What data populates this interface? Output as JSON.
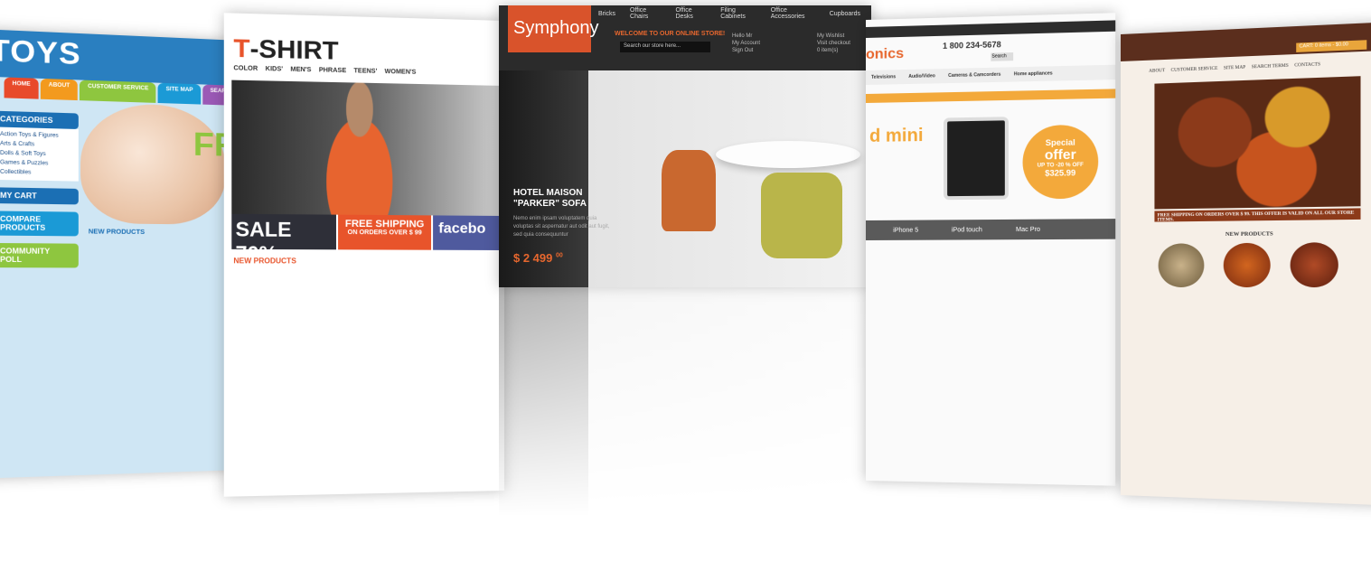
{
  "toys": {
    "logo": "TOYS",
    "nav": [
      "HOME",
      "ABOUT",
      "CUSTOMER SERVICE",
      "SITE MAP",
      "SEARCH TERMS"
    ],
    "categories_title": "CATEGORIES",
    "categories": [
      "Action Toys & Figures",
      "Arts & Crafts",
      "Dolls & Soft Toys",
      "Games & Puzzles",
      "Collectibles"
    ],
    "my_cart": "MY CART",
    "compare": "COMPARE PRODUCTS",
    "community": "COMMUNITY POLL",
    "new_products": "NEW PRODUCTS",
    "hero_text": "FR"
  },
  "tshirt": {
    "logo_first": "T",
    "logo_rest": "-SHIRT",
    "menu": [
      "COLOR",
      "KIDS'",
      "MEN'S",
      "PHRASE",
      "TEENS'",
      "WOMEN'S"
    ],
    "sale": "SALE 70%",
    "free_shipping": "FREE SHIPPING",
    "ship_sub": "ON ORDERS OVER $ 99",
    "facebook": "facebo",
    "new_products": "NEW PRODUCTS"
  },
  "symphony": {
    "brand": "Symphony",
    "nav": [
      "Bricks",
      "Office Chairs",
      "Office Desks",
      "Filing Cabinets",
      "Office Accessories",
      "Cupboards"
    ],
    "welcome": "WELCOME TO OUR ONLINE STORE!",
    "search_placeholder": "Search our store here...",
    "account_lines": [
      "Hello Mr",
      "My Account",
      "Sign Out",
      "My Wishlist",
      "Visit checkout",
      "0 item(s)"
    ],
    "hotel": "HOTEL MAISON",
    "sofa": "\"PARKER\" SOFA",
    "desc": "Nemo enim ipsam voluptatem quia voluptas sit aspernatur aut odit aut fugit, sed quia consequuntur",
    "price": "$ 2 499",
    "price_cents": "00"
  },
  "electronics": {
    "logo": "onics",
    "phone": "1 800 234-5678",
    "nav": [
      "Televisions",
      "Audio/Video",
      "Cameras & Camcorders",
      "Home appliances"
    ],
    "headline": "d mini",
    "offer_title": "Special",
    "offer_word": "offer",
    "offer_sub": "UP TO -20 % OFF",
    "offer_price": "$325.99",
    "tabs": [
      "iPhone 5",
      "iPod touch",
      "Mac Pro"
    ],
    "search": "Search"
  },
  "spices": {
    "nav": [
      "ABOUT",
      "CUSTOMER SERVICE",
      "SITE MAP",
      "SEARCH TERMS",
      "CONTACTS"
    ],
    "cart": "CART: 0 items - $0.00",
    "free_shipping": "FREE SHIPPING ON ORDERS OVER $ 99. THIS OFFER IS VALID ON ALL OUR STORE ITEMS.",
    "new_products": "NEW PRODUCTS"
  },
  "colors": {
    "toys_blue": "#2a7fc0",
    "tshirt_orange": "#e8542b",
    "symphony_orange": "#d9532b",
    "electronics_orange": "#f3a93b",
    "spice_brown": "#5b2e1d"
  }
}
